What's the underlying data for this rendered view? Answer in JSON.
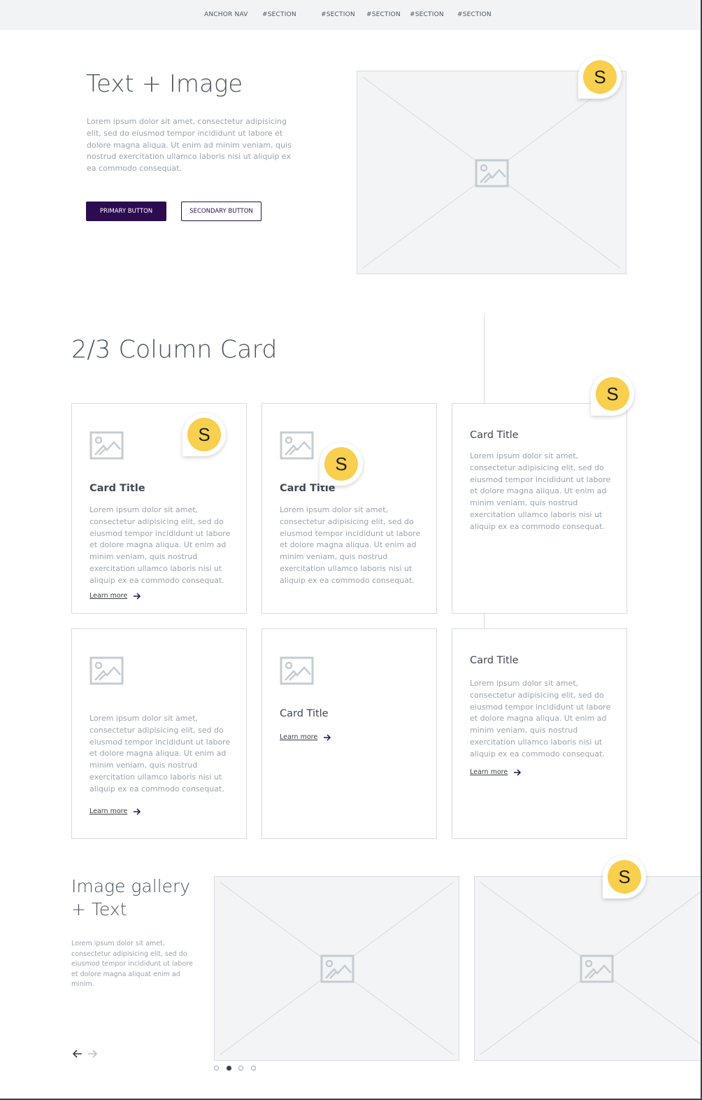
{
  "nav": {
    "items": [
      "ANCHOR NAV",
      "#SECTION",
      "#SECTION",
      "#SECTION",
      "#SECTION",
      "#SECTION"
    ]
  },
  "hero": {
    "title": "Text + Image",
    "body": "Lorem ipsum dolor sit amet, consectetur adipisicing elit, sed do eiusmod tempor incididunt ut labore et dolore magna aliqua. Ut enim ad minim veniam, quis nostrud exercitation ullamco laboris nisi ut aliquip ex ea commodo consequat.",
    "primary_button": "PRIMARY BUTTON",
    "secondary_button": "SECONDARY BUTTON"
  },
  "cards_section": {
    "title": "2/3 Column Card",
    "cards": [
      {
        "title": "Card Title",
        "body": "Lorem ipsum dolor sit amet, consectetur adipisicing elit, sed do eiusmod tempor incididunt ut labore et dolore magna aliqua. Ut enim ad minim veniam, quis nostrud exercitation ullamco laboris nisi ut aliquip ex ea commodo consequat.",
        "link": "Learn more"
      },
      {
        "title": "Card Title",
        "body": "Lorem ipsum dolor sit amet, consectetur adipisicing elit, sed do eiusmod tempor incididunt ut labore et dolore magna aliqua. Ut enim ad minim veniam, quis nostrud exercitation ullamco laboris nisi ut aliquip ex ea commodo consequat."
      },
      {
        "title": "Card Title",
        "body": "Lorem ipsum dolor sit amet, consectetur adipisicing elit, sed do eiusmod tempor incididunt ut labore et dolore magna aliqua. Ut enim ad minim veniam, quis nostrud exercitation ullamco laboris nisi ut aliquip ex ea commodo consequat."
      },
      {
        "body": "Lorem ipsum dolor sit amet, consectetur adipisicing elit, sed do eiusmod tempor incididunt ut labore et dolore magna aliqua. Ut enim ad minim veniam, quis nostrud exercitation ullamco laboris nisi ut aliquip ex ea commodo consequat.",
        "link": "Learn more"
      },
      {
        "title": "Card Title",
        "link": "Learn more"
      },
      {
        "title": "Card Title",
        "body": "Lorem ipsum dolor sit amet, consectetur adipisicing elit, sed do eiusmod tempor incididunt ut labore et dolore magna aliqua. Ut enim ad minim veniam, quis nostrud exercitation ullamco laboris nisi ut aliquip ex ea commodo consequat.",
        "link": "Learn more"
      }
    ]
  },
  "gallery": {
    "title": "Image gallery\n+ Text",
    "body": "Lorem ipsum dolor sit amet, consectetur adipisicing elit, sed do eiusmod tempor incididunt ut labore et dolore magna aliquat enim ad minim.",
    "active_slide": 2,
    "slide_count": 4
  },
  "badge": {
    "letter": "S"
  },
  "icons": {
    "image_placeholder": "image-icon",
    "link_arrow": "arrow-right-icon",
    "gallery_prev": "arrow-left-icon",
    "gallery_next": "arrow-right-icon"
  },
  "colors": {
    "primary": "#2c0b4f",
    "badge": "#f8cf4e",
    "placeholder_bg": "#f3f4f6",
    "muted_text": "#9aa3ad",
    "heading_text": "#4a5560"
  }
}
